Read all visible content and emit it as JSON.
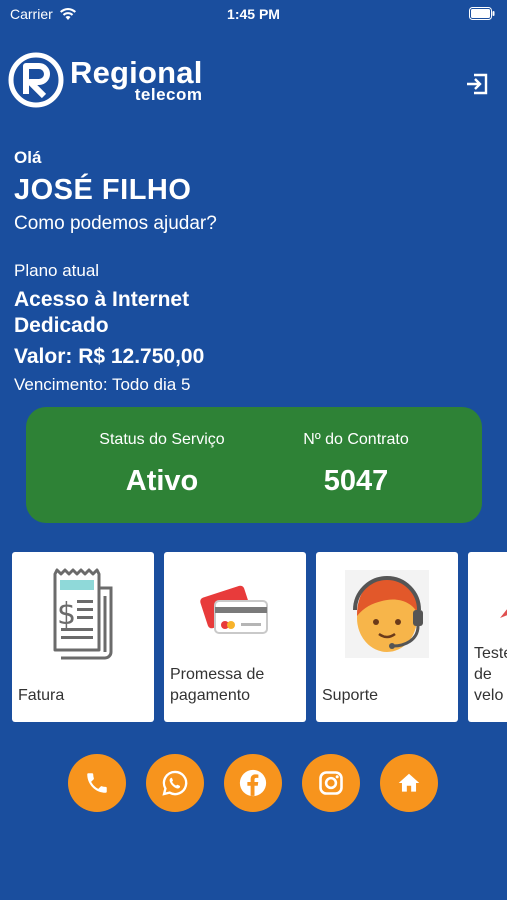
{
  "statusbar": {
    "carrier": "Carrier",
    "time": "1:45 PM"
  },
  "brand": {
    "name": "Regional",
    "sub": "telecom"
  },
  "greeting": {
    "hello": "Olá",
    "name": "JOSÉ FILHO",
    "help": "Como podemos ajudar?"
  },
  "plan": {
    "label": "Plano atual",
    "name": "Acesso à Internet Dedicado",
    "price": "Valor: R$ 12.750,00",
    "due": "Vencimento: Todo dia 5"
  },
  "status": {
    "service_label": "Status do Serviço",
    "service_value": "Ativo",
    "contract_label": "Nº do Contrato",
    "contract_value": "5047"
  },
  "cards": [
    {
      "label": "Fatura",
      "icon": "invoice-icon"
    },
    {
      "label": "Promessa de pagamento",
      "icon": "credit-card-icon"
    },
    {
      "label": "Suporte",
      "icon": "support-agent-icon"
    },
    {
      "label": "Teste de velo",
      "icon": "speed-test-icon"
    }
  ],
  "bottom_buttons": [
    "phone-icon",
    "whatsapp-icon",
    "facebook-icon",
    "instagram-icon",
    "home-icon"
  ],
  "colors": {
    "background": "#1a4e9e",
    "status_card": "#2e8236",
    "accent": "#f7941d"
  }
}
